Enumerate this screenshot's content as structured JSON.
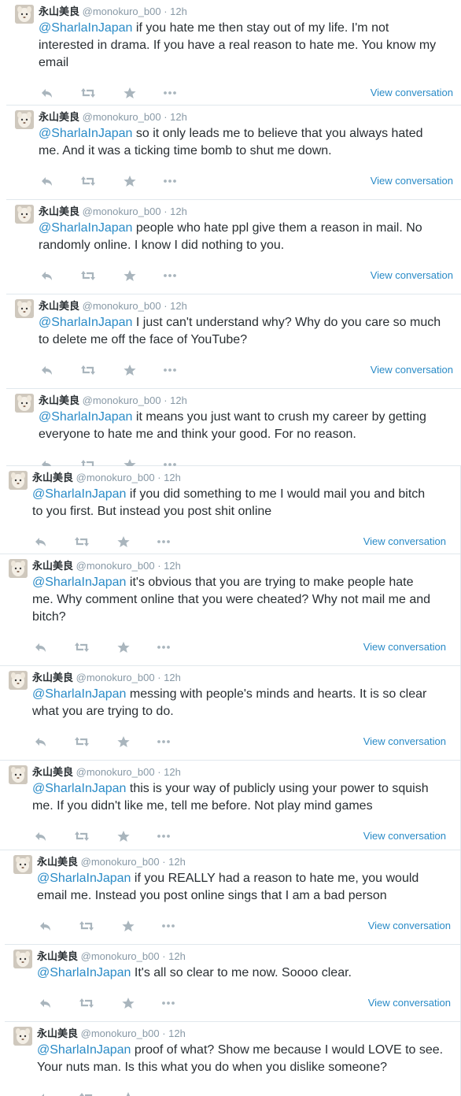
{
  "author": {
    "name": "永山美良",
    "handle": "@monokuro_b00",
    "separator": "·",
    "time": "12h"
  },
  "actions": {
    "reply_icon": "reply-icon",
    "retweet_icon": "retweet-icon",
    "favorite_icon": "star-icon",
    "more_icon": "more-icon",
    "view_conversation_label": "View conversation"
  },
  "colors": {
    "link": "#2a8bc7",
    "text": "#292f33",
    "muted": "#8899a6",
    "icon": "#a9b5bd",
    "divider": "#e1e8ed"
  },
  "tweets": [
    {
      "mention": "@SharlaInJapan",
      "lines": [
        "if you hate me then stay out of my life. I'm not",
        "interested in drama. If you have a real reason to hate me. You know my",
        "email"
      ],
      "show_view_conversation": true
    },
    {
      "mention": "@SharlaInJapan",
      "lines": [
        "so it only leads me to believe that you always hated",
        "me. And it was a ticking time bomb to shut me down."
      ],
      "show_view_conversation": true
    },
    {
      "mention": "@SharlaInJapan",
      "lines": [
        "people who hate ppl give them a reason in mail. No",
        "randomly online. I know I did nothing to you."
      ],
      "show_view_conversation": true
    },
    {
      "mention": "@SharlaInJapan",
      "lines": [
        "I just can't understand why? Why do you care so much",
        "to delete me off the face of YouTube?"
      ],
      "show_view_conversation": true
    },
    {
      "mention": "@SharlaInJapan",
      "lines": [
        "it means you just want to crush my career by getting",
        "everyone to hate me and think your good. For no reason."
      ],
      "show_view_conversation": false
    },
    {
      "mention": "@SharlaInJapan",
      "lines": [
        "if you did something to me I would mail you and bitch",
        "to you first. But instead you post shit online"
      ],
      "show_view_conversation": true
    },
    {
      "mention": "@SharlaInJapan",
      "lines": [
        "it's obvious that you are trying to make people hate",
        "me. Why comment online that you were cheated? Why not mail me and",
        "bitch?"
      ],
      "show_view_conversation": true
    },
    {
      "mention": "@SharlaInJapan",
      "lines": [
        "messing with people's minds and hearts. It is so clear",
        "what you are trying to do."
      ],
      "show_view_conversation": true
    },
    {
      "mention": "@SharlaInJapan",
      "lines": [
        "this is your way of publicly using your power to squish",
        "me. If you didn't like me, tell me before. Not play mind games"
      ],
      "show_view_conversation": true
    },
    {
      "mention": "@SharlaInJapan",
      "lines": [
        "if you REALLY had a reason to hate me, you would",
        "email me. Instead you post online sings that I am a bad person"
      ],
      "show_view_conversation": true
    },
    {
      "mention": "@SharlaInJapan",
      "lines": [
        "It's all so clear to me now. Soooo clear."
      ],
      "show_view_conversation": true
    },
    {
      "mention": "@SharlaInJapan",
      "lines": [
        "proof of what? Show me because I would LOVE to see.",
        "Your nuts man. Is this what you do when you dislike someone?"
      ],
      "show_view_conversation": false
    }
  ]
}
